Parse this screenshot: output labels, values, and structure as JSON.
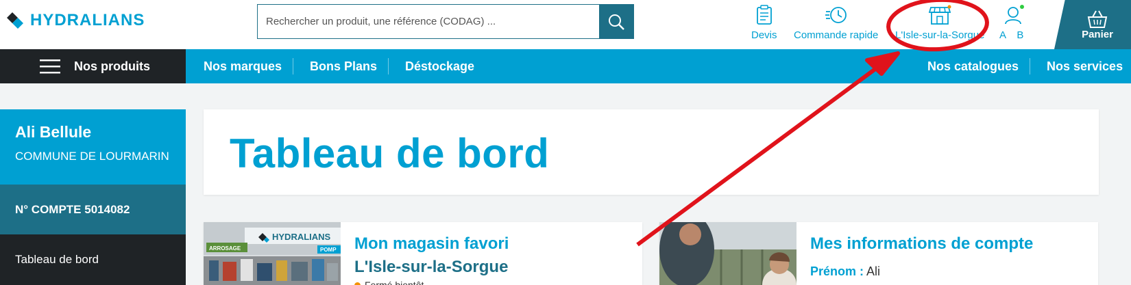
{
  "header": {
    "brand": "HYDRALIANS",
    "search": {
      "placeholder": "Rechercher un produit, une référence (CODAG) ...",
      "icon": "search-icon"
    },
    "nav": [
      {
        "label": "Devis",
        "icon": "clipboard-icon"
      },
      {
        "label": "Commande rapide",
        "icon": "speed-clock-icon"
      },
      {
        "label": "L'Isle-sur-la-Sorgue",
        "icon": "store-icon"
      },
      {
        "label": "A B",
        "icon": "user-icon"
      }
    ],
    "cart": {
      "label": "Panier",
      "icon": "basket-icon"
    }
  },
  "menu": {
    "products_label": "Nos produits",
    "left_links": [
      "Nos marques",
      "Bons Plans",
      "Déstockage"
    ],
    "right_links": [
      "Nos catalogues",
      "Nos services"
    ]
  },
  "sidebar": {
    "user_name": "Ali Bellule",
    "commune": "COMMUNE DE LOURMARIN",
    "account": "N° COMPTE 5014082",
    "links": [
      "Tableau de bord"
    ]
  },
  "main": {
    "title": "Tableau de bord",
    "store_card": {
      "title": "Mon magasin favori",
      "store_name": "L'Isle-sur-la-Sorgue",
      "status": "Fermé bientôt",
      "image_brand": "HYDRALIANS",
      "image_signs": [
        "ARROSAGE",
        "POMP"
      ]
    },
    "account_card": {
      "title": "Mes informations de compte",
      "first_name_label": "Prénom :",
      "first_name": "Ali"
    }
  },
  "colors": {
    "brand_blue": "#00a0d2",
    "dark_teal": "#1d6f87",
    "dark": "#1f2326",
    "annotation_red": "#e0131b",
    "status_orange": "#f39200",
    "notification_green": "#2ecc40"
  }
}
